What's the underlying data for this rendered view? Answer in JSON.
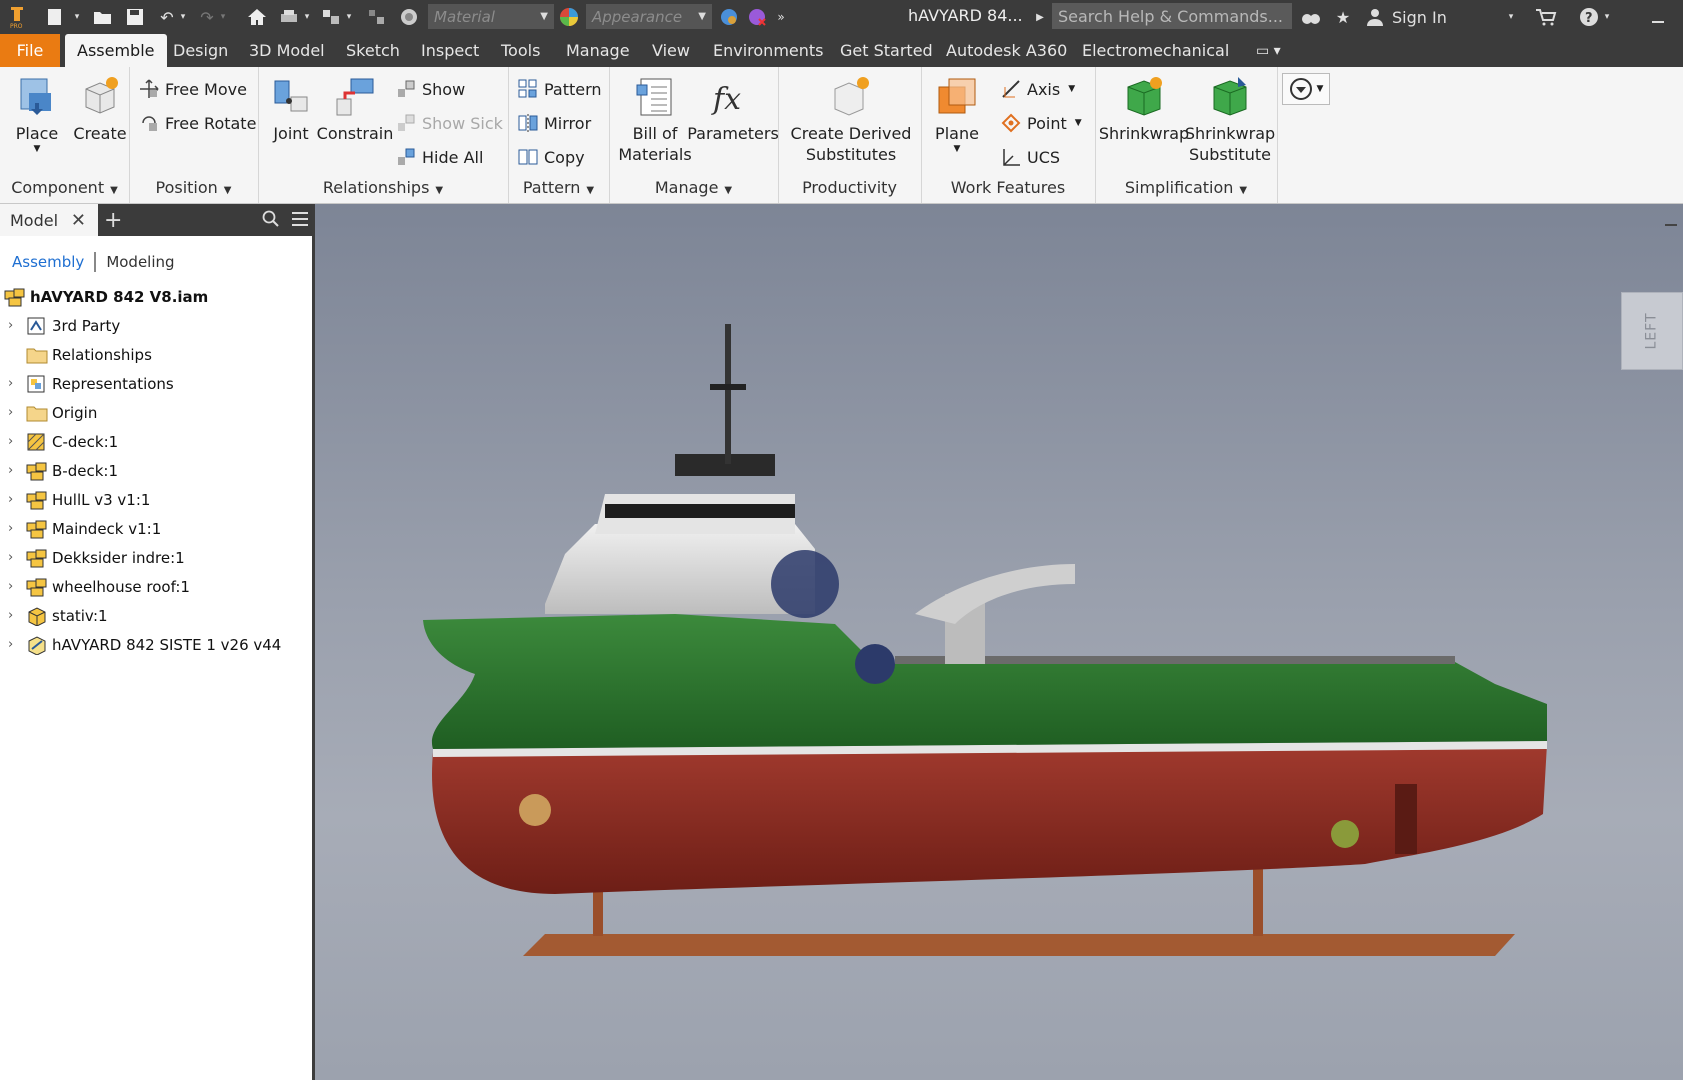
{
  "titlebar": {
    "material_placeholder": "Material",
    "appearance_placeholder": "Appearance",
    "document_title": "hAVYARD 84...",
    "search_placeholder": "Search Help & Commands...",
    "sign_in": "Sign In"
  },
  "tabs": [
    "File",
    "Assemble",
    "Design",
    "3D Model",
    "Sketch",
    "Inspect",
    "Tools",
    "Manage",
    "View",
    "Environments",
    "Get Started",
    "Autodesk A360",
    "Electromechanical"
  ],
  "ribbon": {
    "component": {
      "label": "Component",
      "place": "Place",
      "create": "Create"
    },
    "position": {
      "label": "Position",
      "free_move": "Free Move",
      "free_rotate": "Free Rotate"
    },
    "relationships": {
      "label": "Relationships",
      "joint": "Joint",
      "constrain": "Constrain",
      "show": "Show",
      "show_sick": "Show Sick",
      "hide_all": "Hide All"
    },
    "pattern": {
      "label": "Pattern",
      "pattern": "Pattern",
      "mirror": "Mirror",
      "copy": "Copy"
    },
    "manage": {
      "label": "Manage",
      "bom_line1": "Bill of",
      "bom_line2": "Materials",
      "parameters": "Parameters"
    },
    "productivity": {
      "label": "Productivity",
      "cds_line1": "Create Derived",
      "cds_line2": "Substitutes"
    },
    "work_features": {
      "label": "Work Features",
      "plane": "Plane",
      "axis": "Axis",
      "point": "Point",
      "ucs": "UCS"
    },
    "simplification": {
      "label": "Simplification",
      "shrinkwrap": "Shrinkwrap",
      "sws_line1": "Shrinkwrap",
      "sws_line2": "Substitute"
    }
  },
  "browser": {
    "tab": "Model",
    "mode_assembly": "Assembly",
    "mode_modeling": "Modeling",
    "root": "hAVYARD 842 V8.iam",
    "items": [
      "3rd Party",
      "Relationships",
      "Representations",
      "Origin",
      "C-deck:1",
      "B-deck:1",
      "HullL v3 v1:1",
      "Maindeck v1:1",
      "Dekksider indre:1",
      "wheelhouse roof:1",
      "stativ:1",
      "hAVYARD 842 SISTE 1 v26 v44"
    ]
  },
  "viewport": {
    "viewcube_face": "LEFT"
  }
}
